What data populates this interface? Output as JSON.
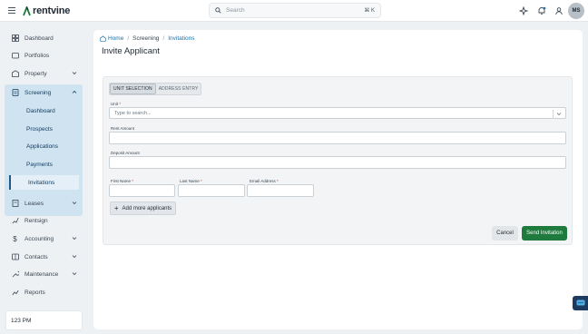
{
  "app": {
    "brand": "rentvine",
    "brand_color": "#1f7a3d"
  },
  "search": {
    "placeholder": "Search",
    "shortcut": "⌘ K"
  },
  "user": {
    "initials": "MS"
  },
  "sidebar": {
    "items": [
      {
        "label": "Dashboard",
        "icon": "dashboard-icon"
      },
      {
        "label": "Portfolios",
        "icon": "portfolio-icon"
      },
      {
        "label": "Property",
        "icon": "property-icon"
      },
      {
        "label": "Screening",
        "icon": "screening-icon"
      },
      {
        "label": "Leases",
        "icon": "leases-icon"
      },
      {
        "label": "Rentsign",
        "icon": "rentsign-icon"
      },
      {
        "label": "Accounting",
        "icon": "dollar-icon"
      },
      {
        "label": "Contacts",
        "icon": "contacts-icon"
      },
      {
        "label": "Maintenance",
        "icon": "wrench-icon"
      },
      {
        "label": "Reports",
        "icon": "reports-icon"
      }
    ],
    "screening_sub": [
      "Dashboard",
      "Prospects",
      "Applications",
      "Payments",
      "Invitations"
    ],
    "clock": "123 PM"
  },
  "breadcrumb": {
    "home": "Home",
    "section": "Screening",
    "current": "Invitations"
  },
  "page": {
    "title": "Invite Applicant"
  },
  "form": {
    "tabs": [
      "UNIT SELECTION",
      "ADDRESS ENTRY"
    ],
    "unit_label": "Unit",
    "unit_placeholder": "Type to search...",
    "rent_label": "Rent Amount",
    "deposit_label": "Deposit Amount",
    "first_name_label": "First Name",
    "last_name_label": "Last Name",
    "email_label": "Email Address",
    "required_marker": "*",
    "add_more": "Add more applicants",
    "cancel": "Cancel",
    "send": "Send Invitation"
  }
}
